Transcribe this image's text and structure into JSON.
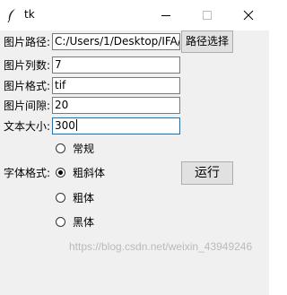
{
  "window": {
    "title": "tk",
    "icon": "feather-icon",
    "controls": [
      "minimize-icon",
      "maximize-icon",
      "close-icon"
    ]
  },
  "form": {
    "path_label": "图片路径:",
    "path_value": "C:/Users/1/Desktop/IFA/",
    "browse_button": "路径选择",
    "columns_label": "图片列数:",
    "columns_value": "7",
    "format_label": "图片格式:",
    "format_value": "tif",
    "gap_label": "图片间隙:",
    "gap_value": "20",
    "textsize_label": "文本大小:",
    "textsize_value": "300",
    "fontstyle_label": "字体格式:",
    "run_button": "运行"
  },
  "font_styles": [
    {
      "label": "常规",
      "checked": false
    },
    {
      "label": "粗斜体",
      "checked": true
    },
    {
      "label": "粗体",
      "checked": false
    },
    {
      "label": "黑体",
      "checked": false
    }
  ],
  "watermark": "https://blog.csdn.net/weixin_43949246"
}
